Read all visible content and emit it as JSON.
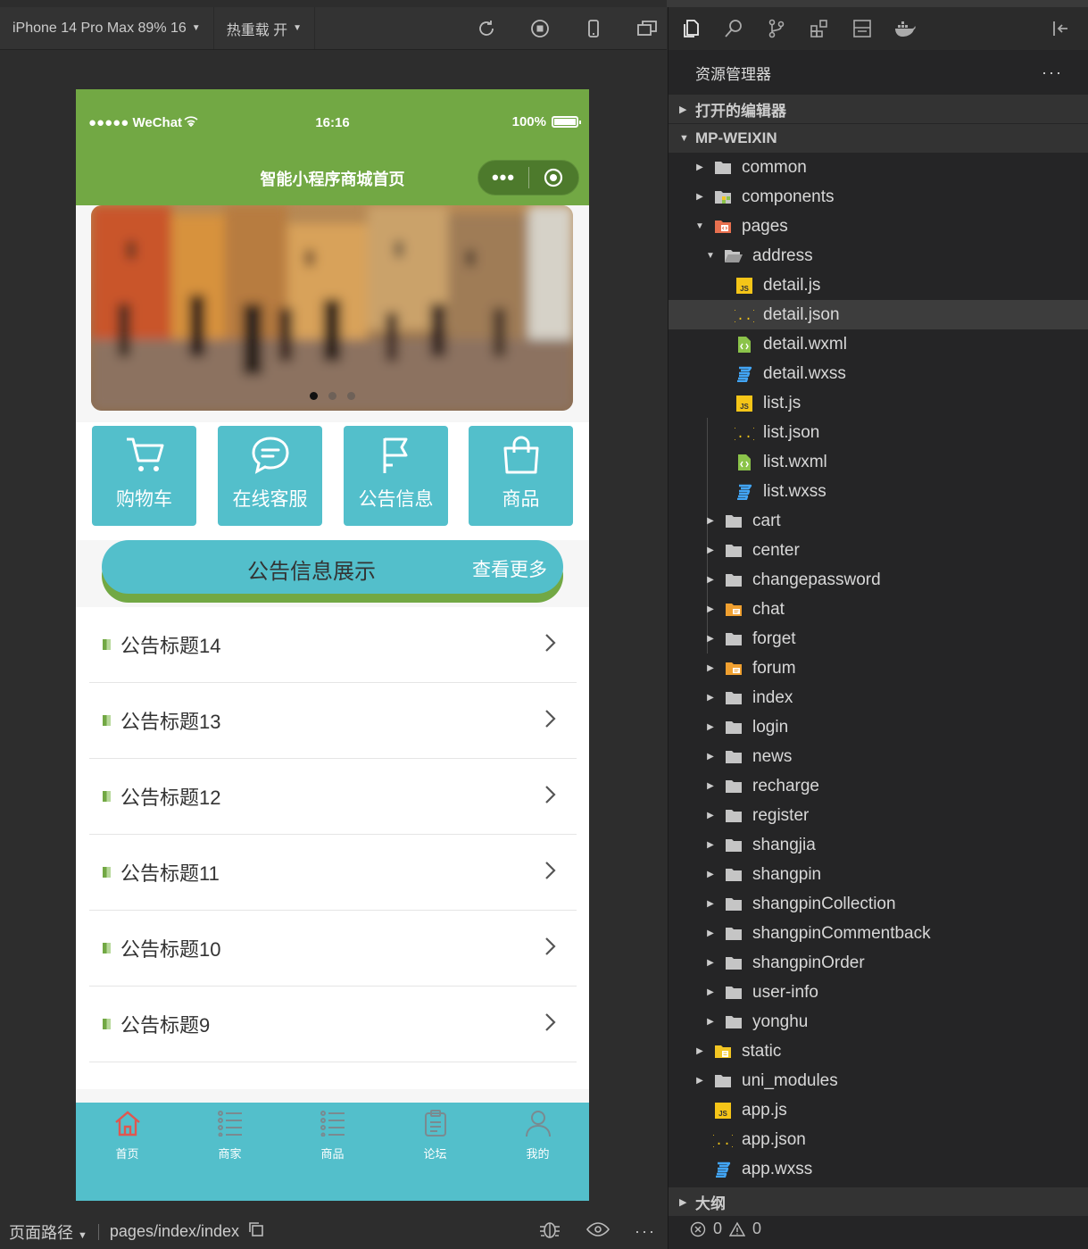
{
  "simulator": {
    "device_label": "iPhone 14 Pro Max 89% 16",
    "hot_reload_label": "热重载 开",
    "toolbar_icons": [
      "refresh-icon",
      "stop-icon",
      "phone-icon",
      "window-icon"
    ]
  },
  "phone": {
    "status_bar": {
      "carrier": "●●●●● WeChat",
      "time": "16:16",
      "battery": "100%"
    },
    "nav_title": "智能小程序商城首页",
    "capsule": {
      "more": "•••"
    },
    "banner": {
      "dots": 3,
      "active_dot": 0
    },
    "menu": [
      {
        "label": "购物车",
        "icon": "cart-icon"
      },
      {
        "label": "在线客服",
        "icon": "chat-bubble-icon"
      },
      {
        "label": "公告信息",
        "icon": "flag-icon"
      },
      {
        "label": "商品",
        "icon": "shopping-bag-icon"
      }
    ],
    "notice_header": {
      "title": "公告信息展示",
      "more": "查看更多"
    },
    "notices": [
      "公告标题14",
      "公告标题13",
      "公告标题12",
      "公告标题11",
      "公告标题10",
      "公告标题9"
    ],
    "tabbar": [
      {
        "label": "首页",
        "icon": "home-icon",
        "active": true
      },
      {
        "label": "商家",
        "icon": "list-icon",
        "active": false
      },
      {
        "label": "商品",
        "icon": "list-icon",
        "active": false
      },
      {
        "label": "论坛",
        "icon": "clipboard-icon",
        "active": false
      },
      {
        "label": "我的",
        "icon": "user-icon",
        "active": false
      }
    ],
    "colors": {
      "primary_green": "#72a844",
      "teal": "#53bfcb"
    }
  },
  "footer": {
    "path_label": "页面路径",
    "path": "pages/index/index"
  },
  "explorer": {
    "title": "资源管理器",
    "more": "···",
    "open_editors": "打开的编辑器",
    "project": "MP-WEIXIN",
    "outline": "大纲",
    "errors": "0",
    "warnings": "0",
    "tree": [
      {
        "name": "common",
        "type": "folder",
        "depth": 1,
        "open": false
      },
      {
        "name": "components",
        "type": "folder-comp",
        "depth": 1,
        "open": false
      },
      {
        "name": "pages",
        "type": "folder-pages",
        "depth": 1,
        "open": true
      },
      {
        "name": "address",
        "type": "folder-open",
        "depth": 2,
        "open": true
      },
      {
        "name": "detail.js",
        "type": "js",
        "depth": 3
      },
      {
        "name": "detail.json",
        "type": "json",
        "depth": 3,
        "selected": true
      },
      {
        "name": "detail.wxml",
        "type": "wxml",
        "depth": 3
      },
      {
        "name": "detail.wxss",
        "type": "wxss",
        "depth": 3
      },
      {
        "name": "list.js",
        "type": "js",
        "depth": 3
      },
      {
        "name": "list.json",
        "type": "json",
        "depth": 3
      },
      {
        "name": "list.wxml",
        "type": "wxml",
        "depth": 3
      },
      {
        "name": "list.wxss",
        "type": "wxss",
        "depth": 3
      },
      {
        "name": "cart",
        "type": "folder",
        "depth": 2,
        "open": false
      },
      {
        "name": "center",
        "type": "folder",
        "depth": 2,
        "open": false
      },
      {
        "name": "changepassword",
        "type": "folder",
        "depth": 2,
        "open": false
      },
      {
        "name": "chat",
        "type": "folder-orange",
        "depth": 2,
        "open": false
      },
      {
        "name": "forget",
        "type": "folder",
        "depth": 2,
        "open": false
      },
      {
        "name": "forum",
        "type": "folder-orange",
        "depth": 2,
        "open": false
      },
      {
        "name": "index",
        "type": "folder",
        "depth": 2,
        "open": false
      },
      {
        "name": "login",
        "type": "folder",
        "depth": 2,
        "open": false
      },
      {
        "name": "news",
        "type": "folder",
        "depth": 2,
        "open": false
      },
      {
        "name": "recharge",
        "type": "folder",
        "depth": 2,
        "open": false
      },
      {
        "name": "register",
        "type": "folder",
        "depth": 2,
        "open": false
      },
      {
        "name": "shangjia",
        "type": "folder",
        "depth": 2,
        "open": false
      },
      {
        "name": "shangpin",
        "type": "folder",
        "depth": 2,
        "open": false
      },
      {
        "name": "shangpinCollection",
        "type": "folder",
        "depth": 2,
        "open": false
      },
      {
        "name": "shangpinCommentback",
        "type": "folder",
        "depth": 2,
        "open": false
      },
      {
        "name": "shangpinOrder",
        "type": "folder",
        "depth": 2,
        "open": false
      },
      {
        "name": "user-info",
        "type": "folder",
        "depth": 2,
        "open": false
      },
      {
        "name": "yonghu",
        "type": "folder",
        "depth": 2,
        "open": false
      },
      {
        "name": "static",
        "type": "folder-yellow",
        "depth": 1,
        "open": false
      },
      {
        "name": "uni_modules",
        "type": "folder",
        "depth": 1,
        "open": false
      },
      {
        "name": "app.js",
        "type": "js",
        "depth": 1
      },
      {
        "name": "app.json",
        "type": "json",
        "depth": 1
      },
      {
        "name": "app.wxss",
        "type": "wxss",
        "depth": 1
      }
    ]
  }
}
